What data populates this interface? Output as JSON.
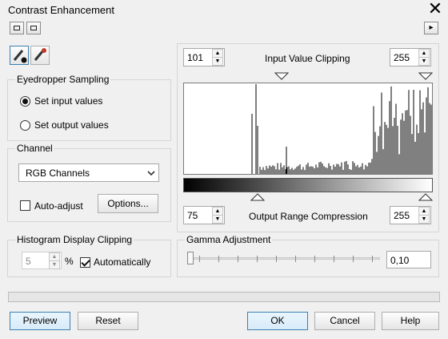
{
  "window": {
    "title": "Contrast Enhancement",
    "close_glyph": "✕"
  },
  "toolbar": {
    "left_buttons": [
      "single-view-icon",
      "dual-view-icon"
    ],
    "right_arrow": "▸"
  },
  "eyedropper": {
    "tools": [
      "eyedropper-icon",
      "eyedropper-plus-icon"
    ],
    "group_title": "Eyedropper Sampling",
    "options": [
      "Set input values",
      "Set output values"
    ],
    "selected_index": 0
  },
  "channel": {
    "group_title": "Channel",
    "selected": "RGB Channels",
    "auto_adjust_label": "Auto-adjust",
    "auto_adjust_checked": false,
    "options_button": "Options..."
  },
  "histogram_clipping": {
    "group_title": "Histogram Display Clipping",
    "value": "5",
    "unit": "%",
    "automatically_label": "Automatically",
    "automatically_checked": true
  },
  "input_clipping": {
    "label": "Input Value Clipping",
    "low": "101",
    "high": "255"
  },
  "output_compression": {
    "label": "Output Range Compression",
    "low": "75",
    "high": "255"
  },
  "gamma": {
    "group_title": "Gamma Adjustment",
    "value": "0,10",
    "slider_level": 0.0
  },
  "buttons": {
    "preview": "Preview",
    "reset": "Reset",
    "ok": "OK",
    "cancel": "Cancel",
    "help": "Help"
  },
  "colors": {
    "accent_border": "#3c7fb1",
    "accent_fill": "#dcedfa",
    "group_border": "#d5d5d5"
  }
}
